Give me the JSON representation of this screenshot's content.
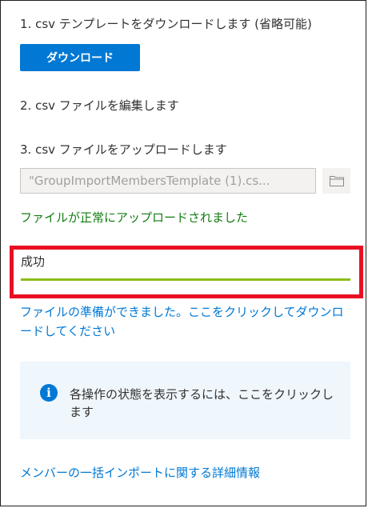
{
  "steps": {
    "step1": "1. csv テンプレートをダウンロードします (省略可能)",
    "download_button": "ダウンロード",
    "step2": "2. csv ファイルを編集します",
    "step3": "3. csv ファイルをアップロードします"
  },
  "upload": {
    "file_value": "\"GroupImportMembersTemplate (1).cs...",
    "browse_icon": "folder-icon",
    "success_message": "ファイルが正常にアップロードされました"
  },
  "status": {
    "label": "成功",
    "progress": 1.0,
    "progress_color": "#8cbd18",
    "highlight_color": "#e81123"
  },
  "results": {
    "download_link": "ファイルの準備ができました。ここをクリックしてダウンロードしてください"
  },
  "info": {
    "icon": "info-icon",
    "glyph": "i",
    "text": "各操作の状態を表示するには、ここをクリックします"
  },
  "footer": {
    "more_info_link": "メンバーの一括インポートに関する詳細情報"
  },
  "colors": {
    "accent": "#0078d4",
    "success": "#107c10",
    "info_background": "#eff6fc"
  }
}
